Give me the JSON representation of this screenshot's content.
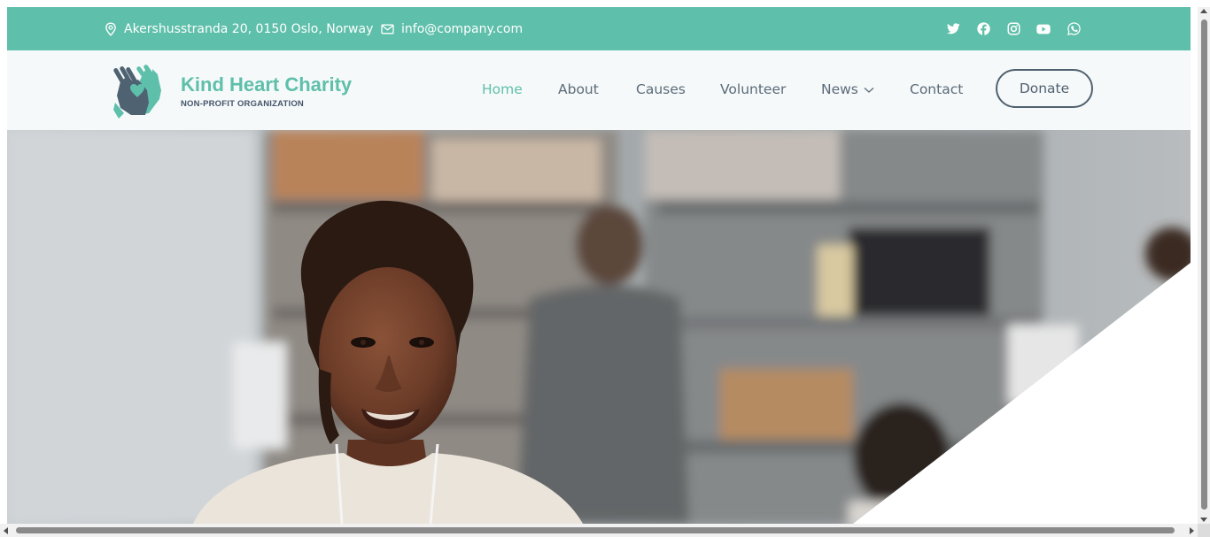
{
  "topbar": {
    "address": "Akershusstranda 20, 0150 Oslo, Norway",
    "email": "info@company.com",
    "icons": {
      "address": "map-pin-icon",
      "email": "envelope-icon"
    },
    "socials": [
      "twitter-icon",
      "facebook-icon",
      "instagram-icon",
      "youtube-icon",
      "whatsapp-icon"
    ]
  },
  "brand": {
    "name": "Kind Heart Charity",
    "tagline": "NON-PROFIT ORGANIZATION",
    "logo_icon": "hands-heart-logo-icon"
  },
  "nav": {
    "items": [
      {
        "label": "Home",
        "active": true
      },
      {
        "label": "About"
      },
      {
        "label": "Causes"
      },
      {
        "label": "Volunteer"
      },
      {
        "label": "News",
        "has_dropdown": true
      },
      {
        "label": "Contact"
      }
    ],
    "donate_label": "Donate"
  },
  "hero": {
    "image": "smiling-volunteer-photo"
  },
  "colors": {
    "accent": "#5ebfaa",
    "dark": "#50616f",
    "header_bg": "#f6f9fa"
  }
}
